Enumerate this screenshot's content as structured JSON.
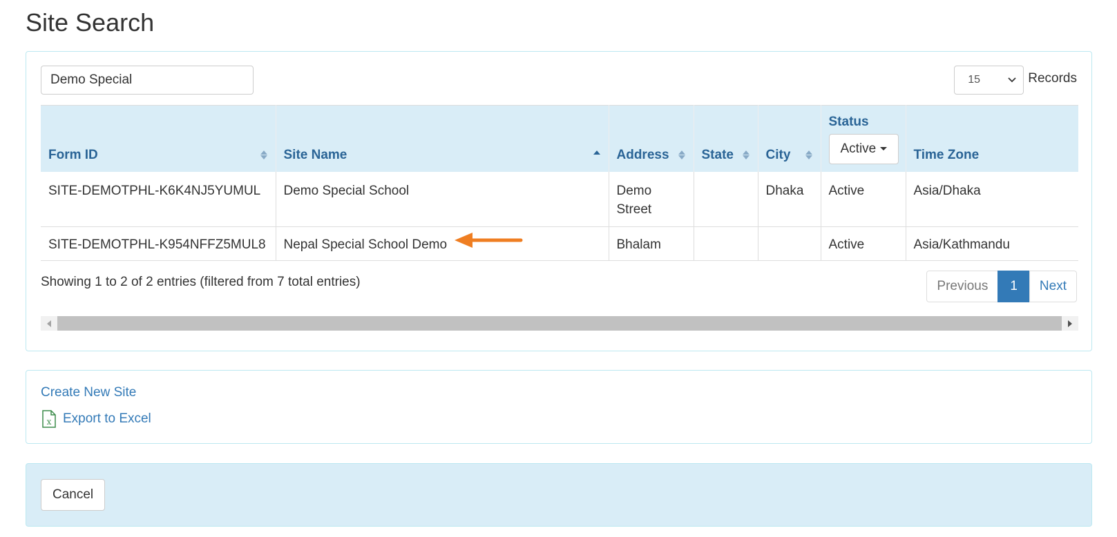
{
  "page": {
    "title": "Site Search"
  },
  "search": {
    "value": "Demo Special"
  },
  "records": {
    "value": "15",
    "label": "Records"
  },
  "table": {
    "headers": {
      "form_id": "Form ID",
      "site_name": "Site Name",
      "address": "Address",
      "state": "State",
      "city": "City",
      "status": "Status",
      "status_filter": "Active",
      "time_zone": "Time Zone"
    },
    "rows": [
      {
        "form_id": "SITE-DEMOTPHL-K6K4NJ5YUMUL",
        "site_name": "Demo Special School",
        "address_line1": "Demo",
        "address_line2": "Street",
        "state": "",
        "city": "Dhaka",
        "status": "Active",
        "time_zone": "Asia/Dhaka"
      },
      {
        "form_id": "SITE-DEMOTPHL-K954NFFZ5MUL8",
        "site_name": "Nepal Special School Demo",
        "address_line1": "Bhalam",
        "address_line2": "",
        "state": "",
        "city": "",
        "status": "Active",
        "time_zone": "Asia/Kathmandu"
      }
    ]
  },
  "info": "Showing 1 to 2 of 2 entries (filtered from 7 total entries)",
  "pagination": {
    "previous": "Previous",
    "current": "1",
    "next": "Next"
  },
  "links": {
    "create": "Create New Site",
    "export": "Export to Excel"
  },
  "footer": {
    "cancel": "Cancel"
  },
  "colors": {
    "header_bg": "#d9edf7",
    "link": "#337ab7",
    "annotation_arrow": "#ef7e22"
  }
}
